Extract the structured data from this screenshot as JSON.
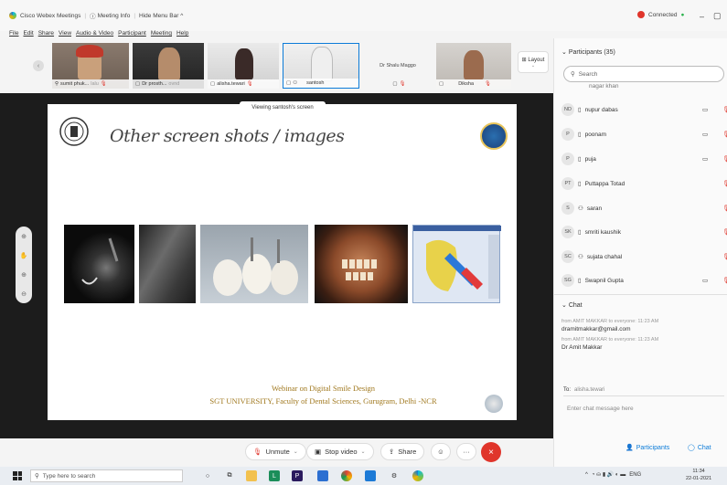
{
  "window": {
    "title": "Cisco Webex Meetings",
    "meeting_info": "Meeting Info",
    "hide_menu": "Hide Menu Bar ^",
    "status": "Connected",
    "min_icon": "minimize-icon",
    "restore_icon": "restore-icon"
  },
  "menu": [
    "File",
    "Edit",
    "Share",
    "View",
    "Audio & Video",
    "Participant",
    "Meeting",
    "Help"
  ],
  "video_strip": {
    "thumbs": [
      {
        "name": "sumit phuk...",
        "extra": "lalu"
      },
      {
        "name": "Dr prosth...",
        "extra": "ovnd"
      },
      {
        "name": "alisha.tewari",
        "extra": ""
      },
      {
        "name": "santosh",
        "extra": ""
      },
      {
        "name": "Dr Shalu Maggo",
        "extra": ""
      },
      {
        "name": "Diksha",
        "extra": ""
      }
    ],
    "layout_label": "Layout"
  },
  "stage": {
    "viewing_label": "Viewing santosh's screen",
    "slide_title": "Other screen shots / images",
    "footer_line1": "Webinar on Digital Smile Design",
    "footer_line2": "SGT UNIVERSITY, Faculty of Dental Sciences,  Gurugram, Delhi -NCR",
    "tools": [
      "⊕",
      "✋",
      "⊕",
      "⊖"
    ]
  },
  "controls": {
    "unmute": "Unmute",
    "stop_video": "Stop video",
    "share": "Share",
    "participants": "Participants",
    "chat": "Chat",
    "more": "···"
  },
  "participants_panel": {
    "header": "Participants (35)",
    "search_placeholder": "Search",
    "truncated_top": "nagar khan",
    "rows": [
      {
        "initials": "ND",
        "name": "nupur dabas",
        "video": true
      },
      {
        "initials": "P",
        "name": "poonam",
        "video": true
      },
      {
        "initials": "P",
        "name": "puja",
        "video": true
      },
      {
        "initials": "PT",
        "name": "Puttappa Totad",
        "video": false
      },
      {
        "initials": "S",
        "name": "saran",
        "video": false
      },
      {
        "initials": "SK",
        "name": "smriti kaushik",
        "video": false
      },
      {
        "initials": "SC",
        "name": "sujata chahal",
        "video": false
      },
      {
        "initials": "SG",
        "name": "Swapnil Gupta",
        "video": true
      }
    ]
  },
  "chat_panel": {
    "header": "Chat",
    "messages": [
      {
        "meta": "from AMIT MAKKAR to everyone:  11:23 AM",
        "text": "dramitmakkar@gmail.com"
      },
      {
        "meta": "from AMIT MAKKAR to everyone:  11:23 AM",
        "text": "Dr Amit Makkar"
      }
    ],
    "to_label": "To:",
    "to_value": "alisha.tewari",
    "input_placeholder": "Enter chat message here"
  },
  "taskbar": {
    "search_placeholder": "Type here to search",
    "lang": "ENG",
    "time": "11:34",
    "date": "22-01-2021"
  },
  "colors": {
    "accent": "#0b7bd8",
    "danger": "#e0352b",
    "connected": "#2bb24c",
    "slide_footer": "#a0781e"
  }
}
